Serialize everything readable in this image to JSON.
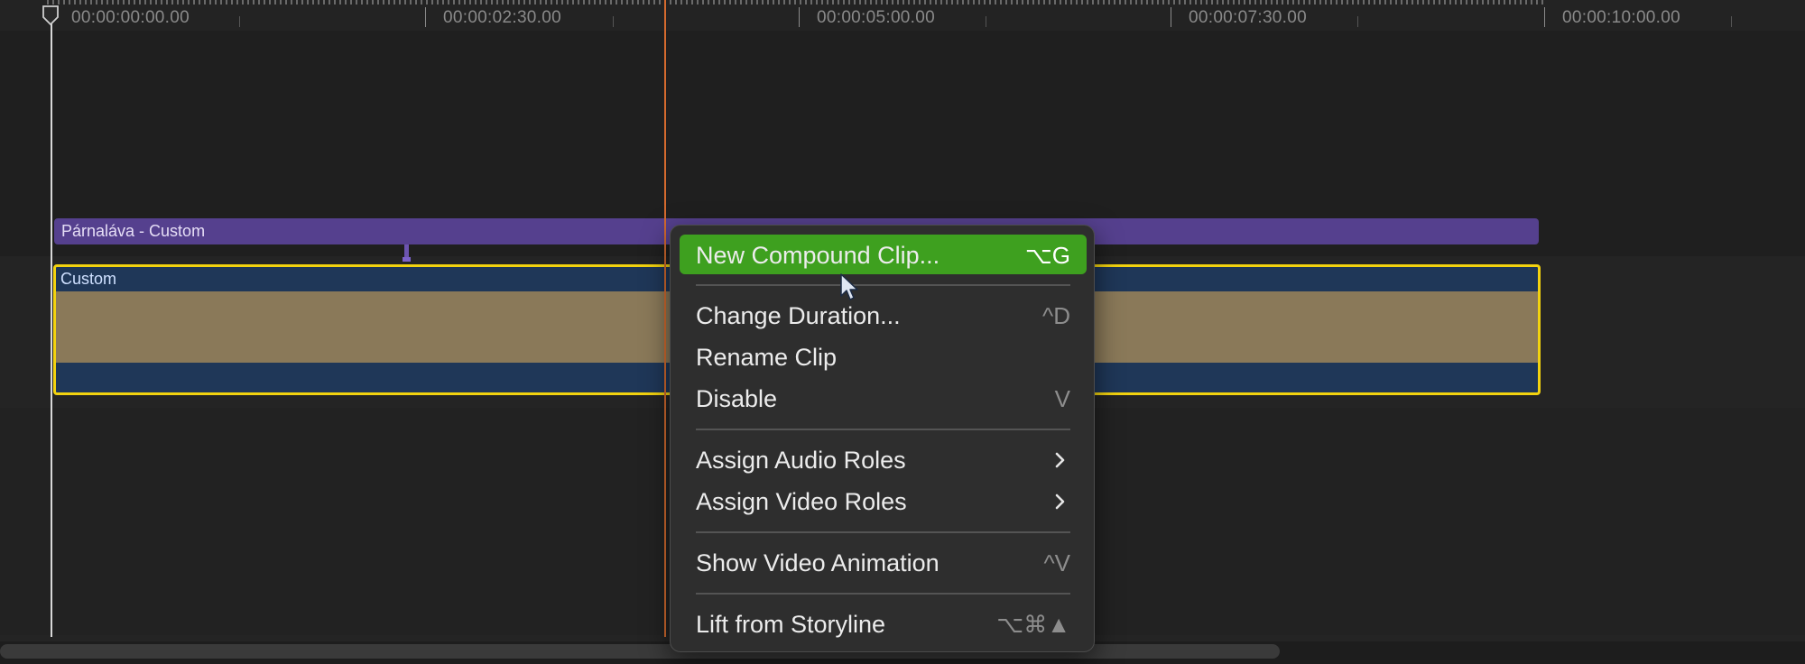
{
  "ruler": {
    "timecodes": [
      "00:00:00:00.00",
      "00:00:02:30.00",
      "00:00:05:00.00",
      "00:00:07:30.00",
      "00:00:10:00.00"
    ]
  },
  "timeline": {
    "connected_clip_label": "Párnaláva - Custom",
    "primary_clip_label": "Custom"
  },
  "context_menu": {
    "new_compound_clip": {
      "label": "New Compound Clip...",
      "shortcut": "⌥G"
    },
    "change_duration": {
      "label": "Change Duration...",
      "shortcut": "^D"
    },
    "rename_clip": {
      "label": "Rename Clip"
    },
    "disable": {
      "label": "Disable",
      "shortcut": "V"
    },
    "assign_audio_roles": {
      "label": "Assign Audio Roles"
    },
    "assign_video_roles": {
      "label": "Assign Video Roles"
    },
    "show_video_animation": {
      "label": "Show Video Animation",
      "shortcut": "^V"
    },
    "lift_from_storyline": {
      "label": "Lift from Storyline",
      "shortcut": "⌥⌘▲"
    }
  },
  "colors": {
    "highlight": "#3ea01f",
    "selection_border": "#f2d20f",
    "connected_clip": "#55408e",
    "skimmer": "#d46a2e"
  }
}
